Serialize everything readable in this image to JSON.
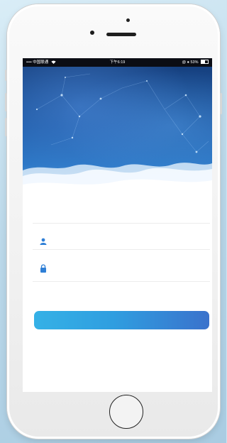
{
  "status_bar": {
    "carrier": "•••• 中国联通",
    "wifi_icon": "wifi-icon",
    "time": "下午6:19",
    "right_icons": "@ ●",
    "battery_percent": "53%",
    "battery_level": 0.53
  },
  "login": {
    "username_placeholder": "",
    "password_placeholder": "",
    "user_icon": "user-icon",
    "lock_icon": "lock-icon",
    "button_label": ""
  },
  "colors": {
    "banner_top": "#16407f",
    "banner_bottom": "#79b4e3",
    "icon_blue": "#2f7fd6",
    "button_left": "#35b1e6",
    "button_right": "#3a72cc"
  }
}
